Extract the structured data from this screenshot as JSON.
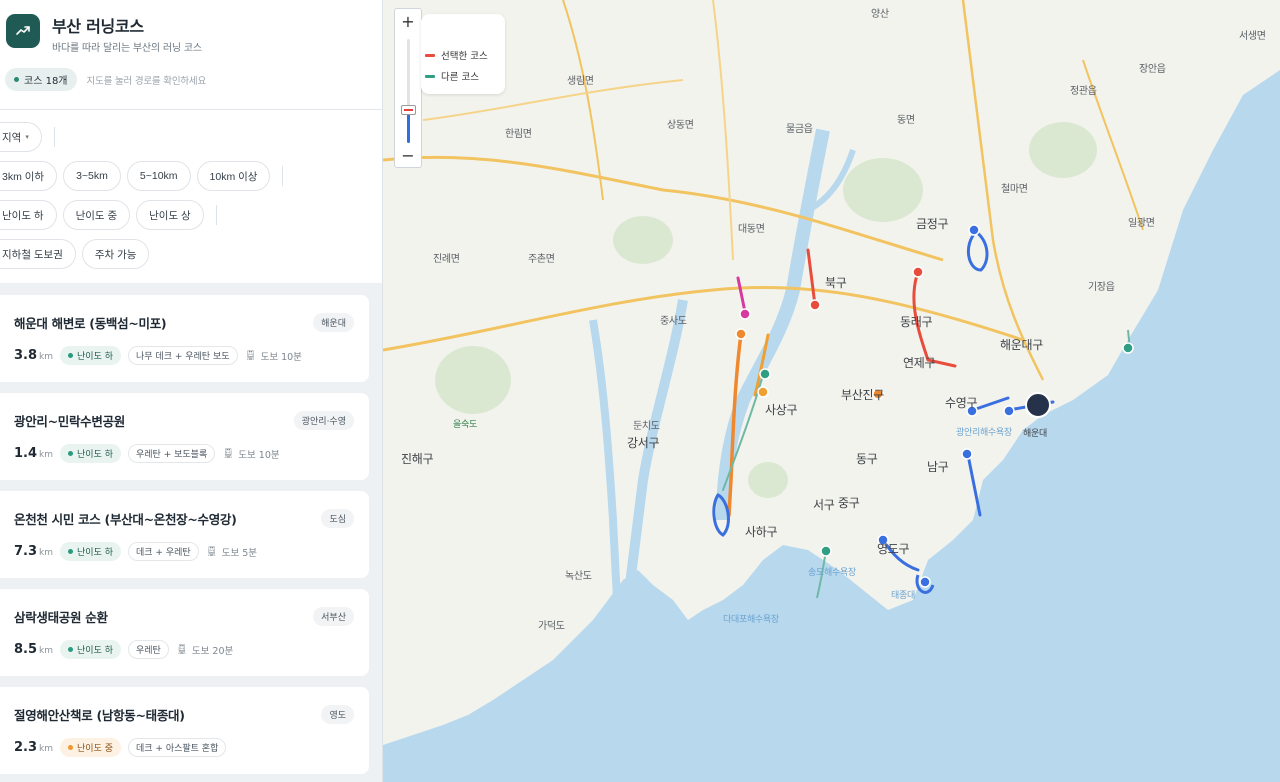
{
  "app": {
    "title": "부산 러닝코스",
    "subtitle": "바다를 따라 달리는 부산의 러닝 코스",
    "course_count": "코스 18개",
    "hint": "지도를 눌러 경로를 확인하세요"
  },
  "filters": {
    "region": "지역",
    "distance": [
      "3km 이하",
      "3~5km",
      "5~10km",
      "10km 이상"
    ],
    "difficulty": [
      "난이도 하",
      "난이도 중",
      "난이도 상"
    ],
    "access": [
      "지하철 도보권",
      "주차 가능"
    ]
  },
  "courses": [
    {
      "name": "해운대 해변로 (동백섬~미포)",
      "region": "해운대",
      "distance": "3.8",
      "unit": "km",
      "difficulty": "난이도 하",
      "surface": "나무 데크 + 우레탄 보도",
      "walk": "도보 10분"
    },
    {
      "name": "광안리~민락수변공원",
      "region": "광안리·수영",
      "distance": "1.4",
      "unit": "km",
      "difficulty": "난이도 하",
      "surface": "우레탄 + 보도블록",
      "walk": "도보 10분"
    },
    {
      "name": "온천천 시민 코스 (부산대~온천장~수영강)",
      "region": "도심",
      "distance": "7.3",
      "unit": "km",
      "difficulty": "난이도 하",
      "surface": "데크 + 우레탄",
      "walk": "도보 5분"
    },
    {
      "name": "삼락생태공원 순환",
      "region": "서부산",
      "distance": "8.5",
      "unit": "km",
      "difficulty": "난이도 하",
      "surface": "우레탄",
      "walk": "도보 20분"
    },
    {
      "name": "절영해안산책로 (남항동~태종대)",
      "region": "영도",
      "distance": "2.3",
      "unit": "km",
      "difficulty": "난이도 중",
      "surface": "데크 + 아스팔트 혼합",
      "walk": ""
    }
  ],
  "map": {
    "legend": {
      "selected": "선택한 코스",
      "other": "다른 코스"
    },
    "zoom_in": "+",
    "zoom_out": "−",
    "zoom_level": 0.3,
    "districts": [
      "금정구",
      "동래구",
      "연제구",
      "해운대구",
      "수영구",
      "부산진구",
      "사상구",
      "북구",
      "동구",
      "남구",
      "서구",
      "중구",
      "영도구",
      "사하구",
      "강서구",
      "기장읍",
      "진해구"
    ],
    "places": [
      "양산",
      "장안읍",
      "정관읍",
      "서생면",
      "물금읍",
      "동면",
      "상동면",
      "생림면",
      "한림면",
      "대동면",
      "진례면",
      "주촌면",
      "철마면",
      "일광면",
      "중사도",
      "둔치도",
      "을숙도",
      "가덕도",
      "녹산도",
      "다대포해수욕장",
      "해운대",
      "태종대",
      "송도해수욕장",
      "광안리해수욕장"
    ],
    "colors": {
      "selected": "#e74c3c",
      "other": "#2f9e82",
      "blue": "#3a6fe0",
      "orange": "#f0892e",
      "pink": "#d63a9e",
      "water": "#b8d8ee",
      "land": "#f4f4ef",
      "park": "#dbe8d1"
    }
  }
}
